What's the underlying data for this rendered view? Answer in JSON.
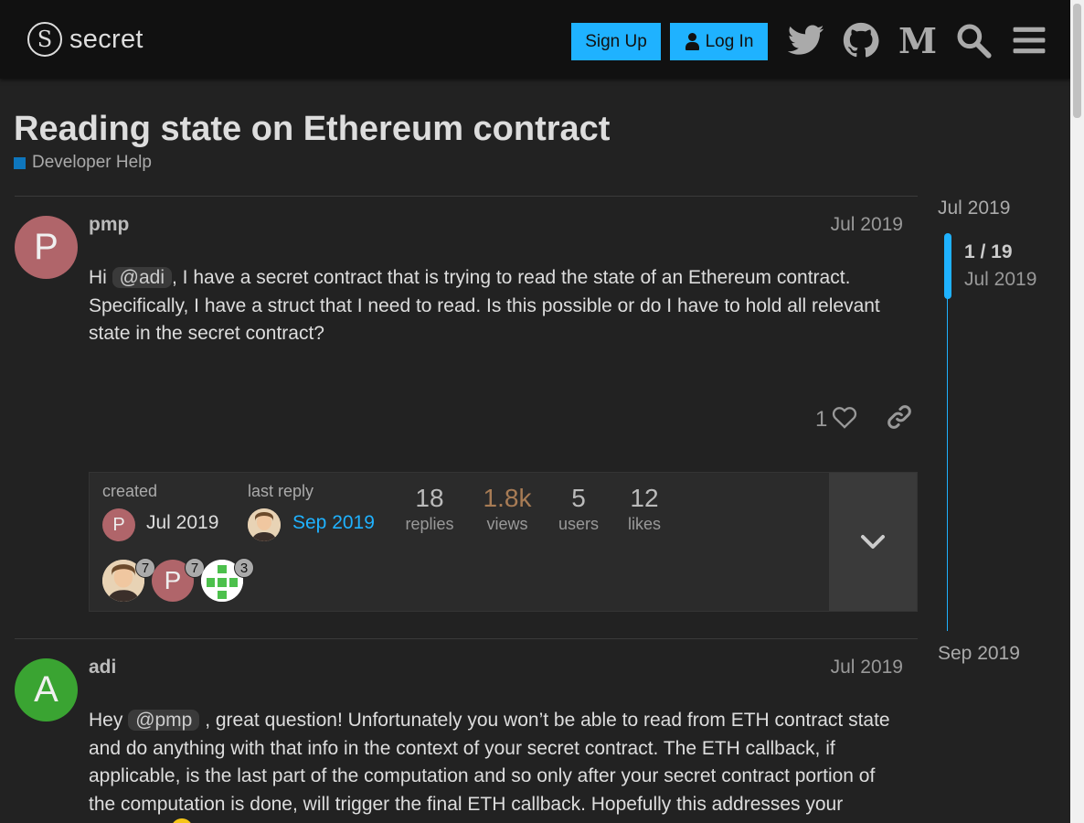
{
  "header": {
    "logo_glyph": "S",
    "logo_text": "secret",
    "signup_label": "Sign Up",
    "login_label": "Log In",
    "icons": [
      "twitter-icon",
      "github-icon",
      "medium-icon",
      "search-icon",
      "hamburger-menu-icon"
    ],
    "accent": "#1fb2ff"
  },
  "topic": {
    "title": "Reading state on Ethereum contract",
    "category": "Developer Help",
    "category_color": "#0e76bd"
  },
  "posts": [
    {
      "avatar_letter": "P",
      "avatar_color": "#b0656a",
      "username": "pmp",
      "date": "Jul 2019",
      "text_pre": "Hi ",
      "mention": "@adi",
      "text_post": ", I have a secret contract that is trying to read the state of an Ethereum contract. Specifically, I have a struct that I need to read. Is this possible or do I have to hold all relevant state in the secret contract?",
      "like_count": "1"
    },
    {
      "avatar_letter": "A",
      "avatar_color": "#3aa432",
      "username": "adi",
      "date": "Jul 2019",
      "text_pre": "Hey ",
      "mention": "@pmp",
      "text_post": " , great question! Unfortunately you won’t be able to read from ETH contract state and do anything with that info in the context of your secret contract. The ETH callback, if applicable, is the last part of the computation and so only after your secret contract portion of the computation is done, will trigger the final ETH callback. Hopefully this addresses your"
    }
  ],
  "topic_map": {
    "created_label": "created",
    "created_date": "Jul 2019",
    "last_reply_label": "last reply",
    "last_reply_date": "Sep 2019",
    "stats": [
      {
        "num": "18",
        "label": "replies"
      },
      {
        "num": "1.8k",
        "label": "views"
      },
      {
        "num": "5",
        "label": "users"
      },
      {
        "num": "12",
        "label": "likes"
      }
    ],
    "participants": [
      {
        "count": "7"
      },
      {
        "letter": "P",
        "count": "7"
      },
      {
        "count": "3"
      }
    ]
  },
  "timeline": {
    "top_date": "Jul 2019",
    "position": "1 / 19",
    "position_date": "Jul 2019",
    "bottom_date": "Sep 2019"
  }
}
